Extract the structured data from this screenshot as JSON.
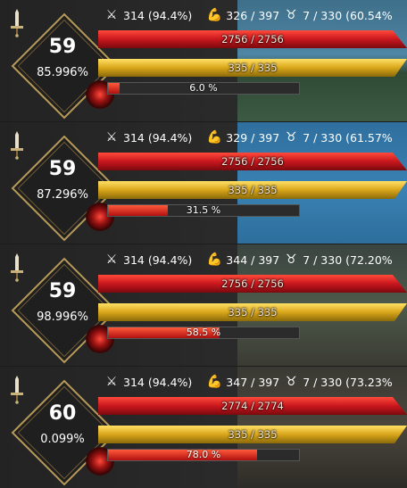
{
  "colors": {
    "hp": "#c9171e",
    "mp": "#d9a61a",
    "frame": "#b89a5a"
  },
  "panels": [
    {
      "level": "59",
      "level_pct": "85.996%",
      "stat_attack": "314 (94.4%)",
      "stat_bag": "326 / 397",
      "stat_gem": "7 / 330 (60.54%",
      "hp_text": "2756 / 2756",
      "mp_text": "335 / 335",
      "xp_text": "6.0 %",
      "xp_fraction": 0.06
    },
    {
      "level": "59",
      "level_pct": "87.296%",
      "stat_attack": "314 (94.4%)",
      "stat_bag": "329 / 397",
      "stat_gem": "7 / 330 (61.57%",
      "hp_text": "2756 / 2756",
      "mp_text": "335 / 335",
      "xp_text": "31.5 %",
      "xp_fraction": 0.315
    },
    {
      "level": "59",
      "level_pct": "98.996%",
      "stat_attack": "314 (94.4%)",
      "stat_bag": "344 / 397",
      "stat_gem": "7 / 330 (72.20%",
      "hp_text": "2756 / 2756",
      "mp_text": "335 / 335",
      "xp_text": "58.5 %",
      "xp_fraction": 0.585
    },
    {
      "level": "60",
      "level_pct": "0.099%",
      "stat_attack": "314 (94.4%)",
      "stat_bag": "347 / 397",
      "stat_gem": "7 / 330 (73.23%",
      "hp_text": "2774 / 2774",
      "mp_text": "335 / 335",
      "xp_text": "78.0 %",
      "xp_fraction": 0.78
    }
  ]
}
